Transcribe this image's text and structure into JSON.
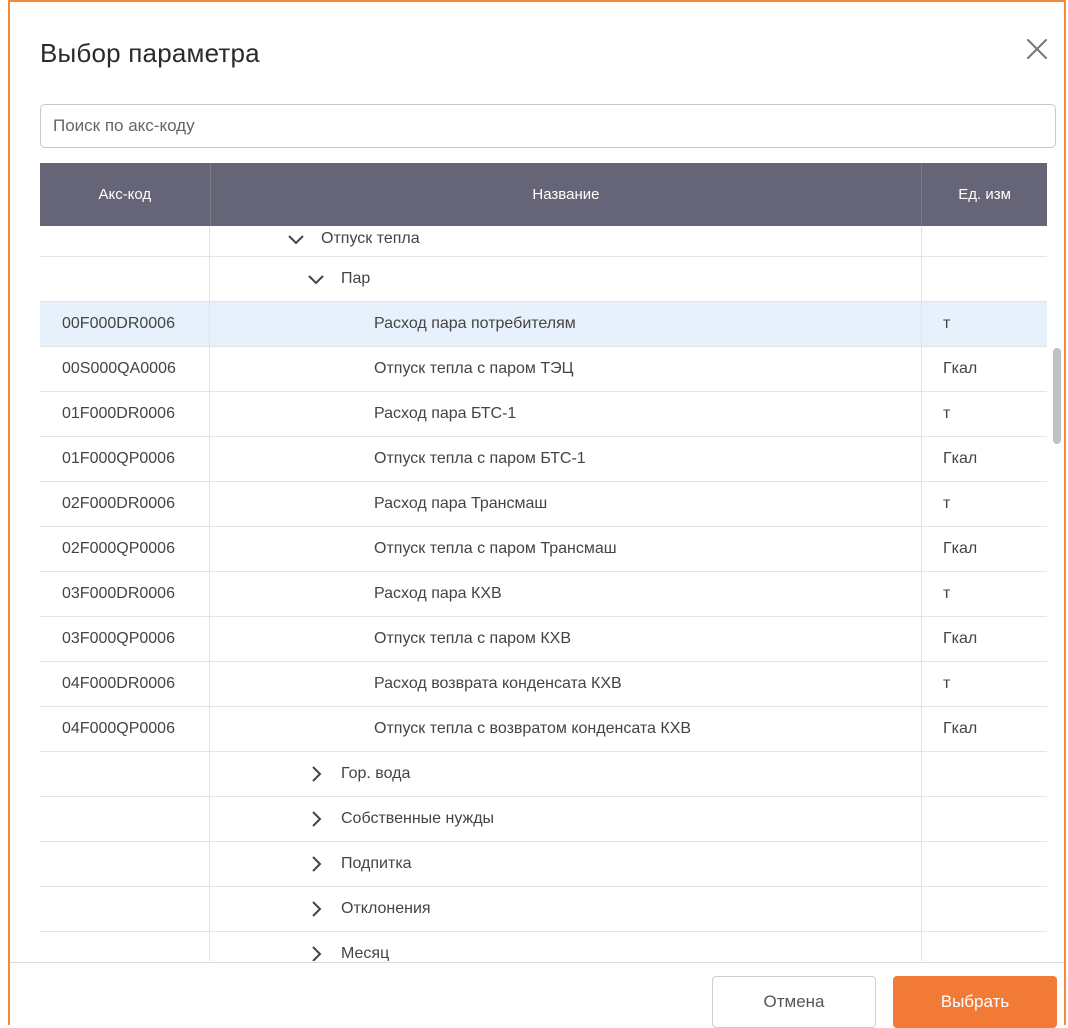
{
  "dialog": {
    "title": "Выбор параметра",
    "close_icon": "close-icon"
  },
  "search": {
    "placeholder": "Поиск по акс-коду",
    "value": ""
  },
  "table": {
    "headers": [
      "Акс-код",
      "Название",
      "Ед. изм"
    ],
    "rows": [
      {
        "code": "",
        "name": "Отпуск тепла",
        "unit": "",
        "level": 1,
        "expander": "expanded"
      },
      {
        "code": "",
        "name": "Пар",
        "unit": "",
        "level": 2,
        "expander": "expanded"
      },
      {
        "code": "00F000DR0006",
        "name": "Расход пара потребителям",
        "unit": "т",
        "level": 3,
        "selected": true
      },
      {
        "code": "00S000QA0006",
        "name": "Отпуск тепла с паром ТЭЦ",
        "unit": "Гкал",
        "level": 3
      },
      {
        "code": "01F000DR0006",
        "name": "Расход пара БТС-1",
        "unit": "т",
        "level": 3
      },
      {
        "code": "01F000QP0006",
        "name": "Отпуск тепла с паром БТС-1",
        "unit": "Гкал",
        "level": 3
      },
      {
        "code": "02F000DR0006",
        "name": "Расход пара Трансмаш",
        "unit": "т",
        "level": 3
      },
      {
        "code": "02F000QP0006",
        "name": "Отпуск тепла с паром Трансмаш",
        "unit": "Гкал",
        "level": 3
      },
      {
        "code": "03F000DR0006",
        "name": "Расход пара КХВ",
        "unit": "т",
        "level": 3
      },
      {
        "code": "03F000QP0006",
        "name": "Отпуск тепла с паром КХВ",
        "unit": "Гкал",
        "level": 3
      },
      {
        "code": "04F000DR0006",
        "name": "Расход возврата конденсата КХВ",
        "unit": "т",
        "level": 3
      },
      {
        "code": "04F000QP0006",
        "name": "Отпуск тепла с возвратом конденсата КХВ",
        "unit": "Гкал",
        "level": 3
      },
      {
        "code": "",
        "name": "Гор. вода",
        "unit": "",
        "level": 2,
        "expander": "collapsed"
      },
      {
        "code": "",
        "name": "Собственные нужды",
        "unit": "",
        "level": 2,
        "expander": "collapsed"
      },
      {
        "code": "",
        "name": "Подпитка",
        "unit": "",
        "level": 2,
        "expander": "collapsed"
      },
      {
        "code": "",
        "name": "Отклонения",
        "unit": "",
        "level": 2,
        "expander": "collapsed"
      },
      {
        "code": "",
        "name": "Месяц",
        "unit": "",
        "level": 2,
        "expander": "collapsed"
      }
    ]
  },
  "footer": {
    "cancel_label": "Отмена",
    "ok_label": "Выбрать"
  },
  "colors": {
    "accent": "#f07a36",
    "header_bg": "#656577",
    "selected_row": "#e6f1fb"
  }
}
